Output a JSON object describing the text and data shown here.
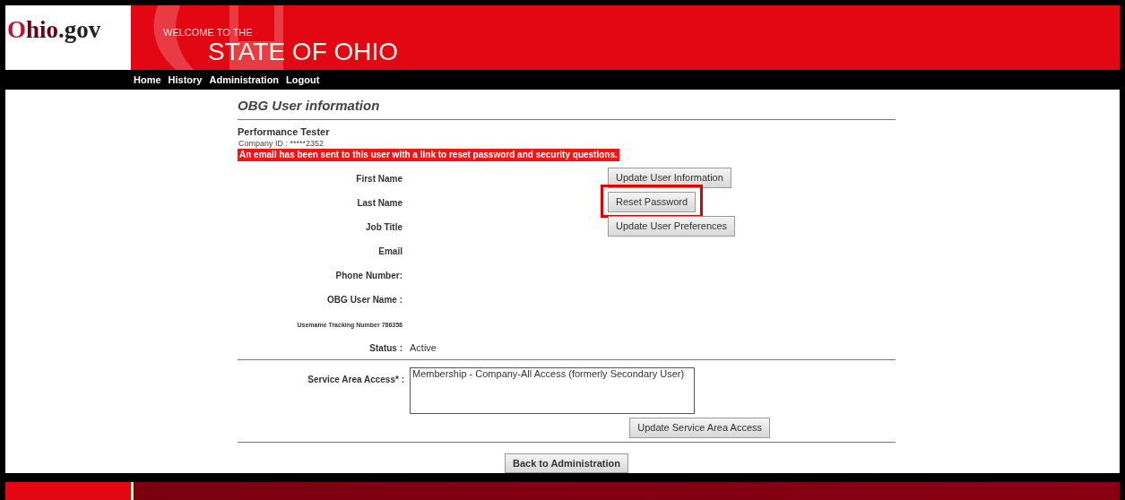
{
  "header": {
    "logo": "Ohio.gov",
    "welcome": "WELCOME TO THE",
    "state": "STATE OF OHIO"
  },
  "nav": [
    {
      "label": "Home"
    },
    {
      "label": "History"
    },
    {
      "label": "Administration"
    },
    {
      "label": "Logout"
    }
  ],
  "page_title": "OBG User information",
  "user": {
    "name": "Performance Tester",
    "company_id": "Company ID : *****2352",
    "alert": "An email has been sent to this user with a link to reset password and security questions."
  },
  "fields": [
    {
      "label": "First Name",
      "button": {
        "label": "Update User Information",
        "highlighted": false
      }
    },
    {
      "label": "Last Name",
      "button": {
        "label": "Reset Password",
        "highlighted": true
      }
    },
    {
      "label": "Job Title",
      "button": {
        "label": "Update User Preferences",
        "highlighted": false
      }
    },
    {
      "label": "Email"
    },
    {
      "label": "Phone Number:"
    },
    {
      "label": "OBG User Name :"
    },
    {
      "label": "Usemame Tracking Number 786358",
      "small": true
    },
    {
      "label": "Status :",
      "value": "Active"
    }
  ],
  "service_area": {
    "label": "Service Area Access* :",
    "value": "Membership - Company-All Access (formerly Secondary User)",
    "button": "Update Service Area Access"
  },
  "back_button": "Back to Administration"
}
